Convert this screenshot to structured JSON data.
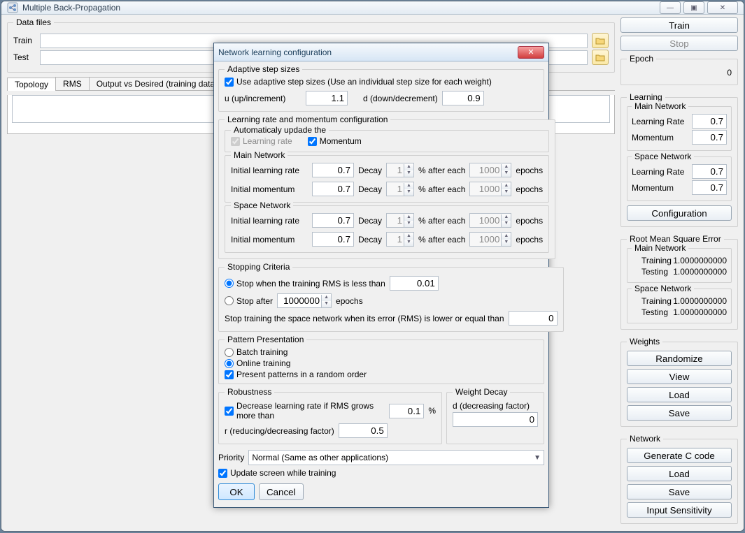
{
  "app_title": "Multiple Back-Propagation",
  "win_controls": {
    "min": "—",
    "max": "▣",
    "close": "✕"
  },
  "data_files": {
    "legend": "Data files",
    "train_label": "Train",
    "test_label": "Test",
    "train_value": "",
    "test_value": ""
  },
  "top_buttons": {
    "train": "Train",
    "stop": "Stop"
  },
  "tabs": [
    "Topology",
    "RMS",
    "Output vs Desired (training data)"
  ],
  "active_tab": 0,
  "right": {
    "epoch": {
      "legend": "Epoch",
      "value": "0"
    },
    "learning": {
      "legend": "Learning",
      "main": {
        "legend": "Main Network",
        "lr_label": "Learning Rate",
        "lr": "0.7",
        "mom_label": "Momentum",
        "mom": "0.7"
      },
      "space": {
        "legend": "Space Network",
        "lr_label": "Learning Rate",
        "lr": "0.7",
        "mom_label": "Momentum",
        "mom": "0.7"
      },
      "config_btn": "Configuration"
    },
    "rms": {
      "legend": "Root Mean Square Error",
      "main": {
        "legend": "Main Network",
        "training_label": "Training",
        "training": "1.0000000000",
        "testing_label": "Testing",
        "testing": "1.0000000000"
      },
      "space": {
        "legend": "Space Network",
        "training_label": "Training",
        "training": "1.0000000000",
        "testing_label": "Testing",
        "testing": "1.0000000000"
      }
    },
    "weights": {
      "legend": "Weights",
      "randomize": "Randomize",
      "view": "View",
      "load": "Load",
      "save": "Save"
    },
    "network": {
      "legend": "Network",
      "gen_c": "Generate C code",
      "load": "Load",
      "save": "Save",
      "sens": "Input Sensitivity"
    }
  },
  "dialog": {
    "title": "Network learning configuration",
    "close": "✕",
    "adaptive": {
      "legend": "Adaptive step sizes",
      "use_adaptive": "Use adaptive step sizes (Use an individual step size for each weight)",
      "u_label": "u (up/increment)",
      "u_value": "1.1",
      "d_label": "d (down/decrement)",
      "d_value": "0.9"
    },
    "lr_momentum": {
      "legend": "Learning rate and momentum configuration",
      "auto_legend": "Automaticaly updade the",
      "auto_lr": "Learning rate",
      "auto_mom": "Momentum",
      "main": {
        "legend": "Main Network",
        "ilr_label": "Initial learning rate",
        "ilr": "0.7",
        "decay_label": "Decay",
        "decay_pct": "1",
        "after_each": "% after each",
        "epochs_val": "1000",
        "epochs_word": "epochs",
        "imom_label": "Initial momentum",
        "imom": "0.7"
      },
      "space": {
        "legend": "Space Network",
        "ilr_label": "Initial learning rate",
        "ilr": "0.7",
        "decay_label": "Decay",
        "decay_pct": "1",
        "after_each": "% after each",
        "epochs_val": "1000",
        "epochs_word": "epochs",
        "imom_label": "Initial momentum",
        "imom": "0.7"
      }
    },
    "stopping": {
      "legend": "Stopping Criteria",
      "opt_rms": "Stop when the training RMS is less than",
      "rms_value": "0.01",
      "opt_after": "Stop after",
      "after_value": "1000000",
      "epochs_word": "epochs",
      "space_stop": "Stop training the space network when its error (RMS) is lower or equal than",
      "space_stop_value": "0"
    },
    "pattern": {
      "legend": "Pattern Presentation",
      "batch": "Batch training",
      "online": "Online training",
      "random_order": "Present patterns in a random order"
    },
    "robust": {
      "legend": "Robustness",
      "dec_lr": "Decrease learning rate if RMS grows more than",
      "dec_value": "0.1",
      "pct": "%",
      "r_label": "r (reducing/decreasing factor)",
      "r_value": "0.5"
    },
    "weight_decay": {
      "legend": "Weight Decay",
      "d_label": "d (decreasing factor)",
      "d_value": "0"
    },
    "priority": {
      "label": "Priority",
      "value": "Normal (Same as other applications)"
    },
    "update_screen": "Update screen while training",
    "ok": "OK",
    "cancel": "Cancel"
  }
}
